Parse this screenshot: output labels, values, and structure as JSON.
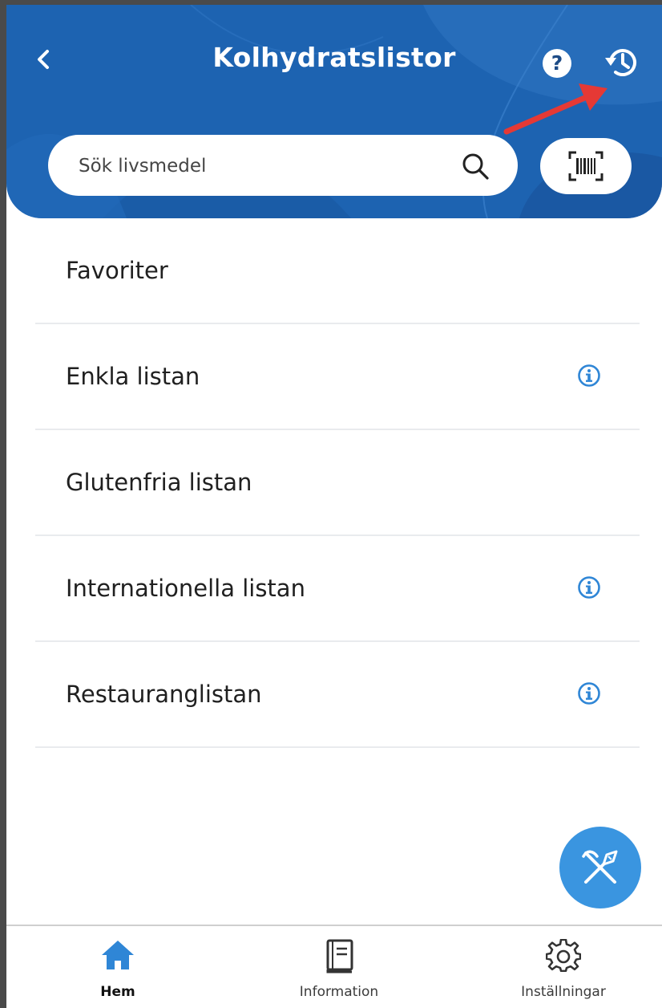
{
  "header": {
    "title": "Kolhydratslistor",
    "help_symbol": "?",
    "background_color": "#1d63b1"
  },
  "search": {
    "placeholder": "Sök livsmedel",
    "value": ""
  },
  "icons": {
    "back": "chevron-left-icon",
    "help": "question-circle-icon",
    "history": "history-icon",
    "search": "search-icon",
    "barcode": "barcode-scan-icon",
    "info": "info-icon",
    "fab": "utensils-icon",
    "home": "home-icon",
    "information": "book-icon",
    "settings": "gear-icon"
  },
  "lists": [
    {
      "label": "Favoriter",
      "info": false
    },
    {
      "label": "Enkla listan",
      "info": true
    },
    {
      "label": "Glutenfria listan",
      "info": false
    },
    {
      "label": "Internationella listan",
      "info": true
    },
    {
      "label": "Restauranglistan",
      "info": true
    }
  ],
  "bottom_nav": [
    {
      "label": "Hem",
      "active": true
    },
    {
      "label": "Information",
      "active": false
    },
    {
      "label": "Inställningar",
      "active": false
    }
  ],
  "colors": {
    "accent": "#3a95e0",
    "annotation_arrow": "#e53935",
    "nav_active": "#2f86d6",
    "divider": "#e9ebee"
  }
}
